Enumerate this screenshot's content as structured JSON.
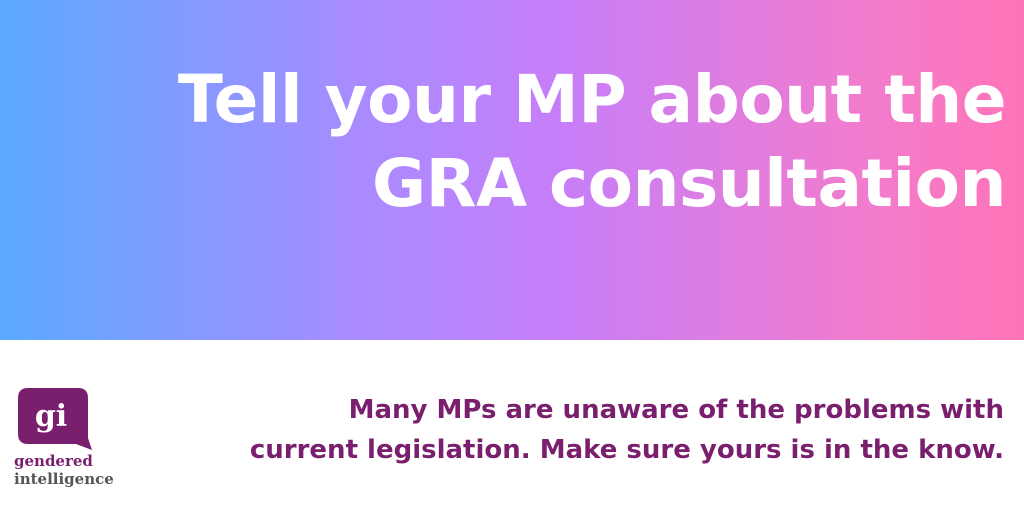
{
  "headline": {
    "line1": "Tell your MP about the",
    "line2": "GRA consultation"
  },
  "message": {
    "line1": "Many MPs are unaware of the problems with",
    "line2": "current legislation. Make sure yours is in the know."
  },
  "logo": {
    "mark": "gi",
    "line1": "gendered",
    "line2": "intelligence"
  },
  "colors": {
    "gradient_start": "#5aaaff",
    "gradient_end": "#ff74b8",
    "brand_purple": "#7a1f6e",
    "headline_text": "#ffffff",
    "logo_secondary": "#555555"
  },
  "icons": {
    "logo_mark": "speech-bubble-icon"
  }
}
